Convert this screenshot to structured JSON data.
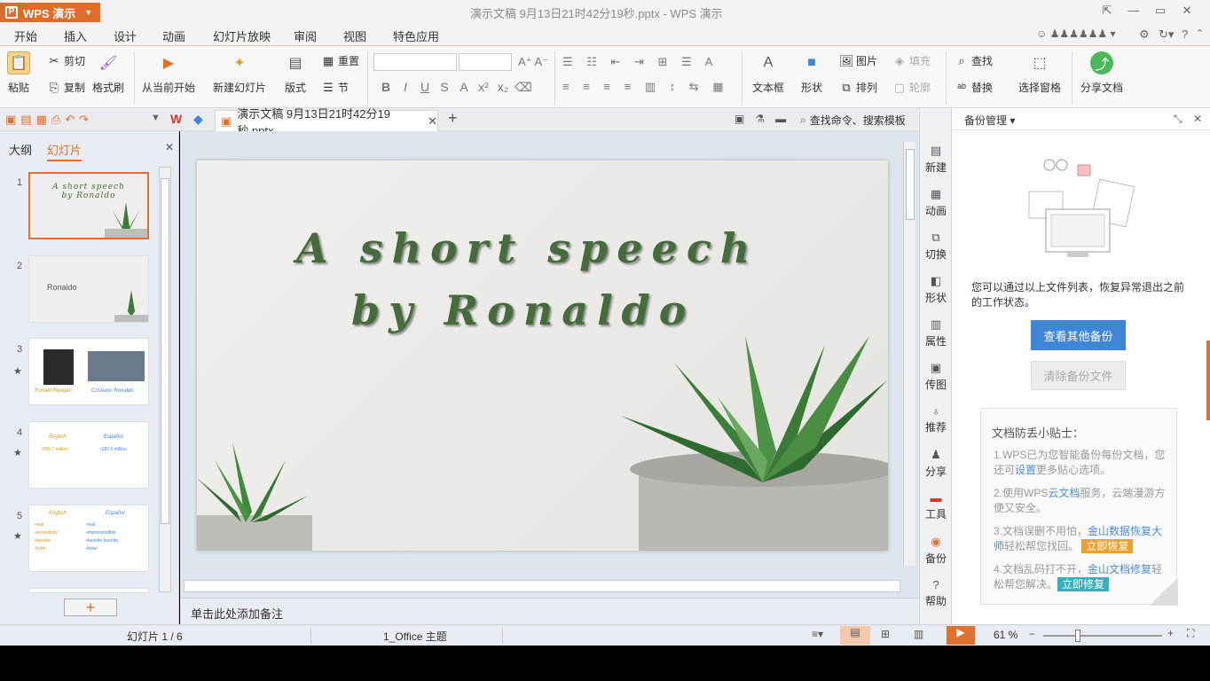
{
  "app": {
    "name": "WPS 演示",
    "doc_title": "演示文稿 9月13日21时42分19秒.pptx - WPS 演示"
  },
  "menu": [
    "开始",
    "插入",
    "设计",
    "动画",
    "幻灯片放映",
    "审阅",
    "视图",
    "特色应用"
  ],
  "ribbon": {
    "paste": "粘贴",
    "cut": "剪切",
    "copy": "复制",
    "format_painter": "格式刷",
    "from_current": "从当前开始",
    "new_slide": "新建幻灯片",
    "layout": "版式",
    "reset": "重置",
    "section": "节",
    "textbox": "文本框",
    "shape": "形状",
    "picture": "图片",
    "fill": "填充",
    "arrange": "排列",
    "outline": "轮廓",
    "find": "查找",
    "replace": "替换",
    "select_pane": "选择窗格",
    "share_doc": "分享文档"
  },
  "tabs": {
    "doc_tab": "演示文稿 9月13日21时42分19秒.pptx",
    "search_cmd": "查找命令、搜索模板"
  },
  "left_panel": {
    "tab_outline": "大纲",
    "tab_slides": "幻灯片"
  },
  "thumbs": {
    "t1": {
      "num": "1",
      "line1": "A short speech",
      "line2": "by Ronaldo"
    },
    "t2": {
      "num": "2",
      "text": "Ronaldo"
    },
    "t3": {
      "num": "3",
      "cap1": "Ronald Reagan",
      "cap2": "Cristiano Ronaldo"
    },
    "t4": {
      "num": "4",
      "h1": "English",
      "h2": "Español",
      "v1": "•300.7 million",
      "v2": "•383.5 million"
    },
    "t5": {
      "num": "5",
      "h1": "English",
      "h2": "Español",
      "c1": [
        "•real",
        "•serendipity",
        "•favorite",
        "•hotel"
      ],
      "c2": [
        "•real",
        "•imprescindible",
        "•favorito favorita",
        "•hotel"
      ]
    }
  },
  "slide": {
    "line1": "A short speech",
    "line2": "by Ronaldo"
  },
  "notes_placeholder": "单击此处添加备注",
  "side_tools": [
    "新建",
    "动画",
    "切换",
    "形状",
    "属性",
    "传图",
    "推荐",
    "分享",
    "工具",
    "备份",
    "帮助"
  ],
  "backup": {
    "title": "备份管理",
    "desc": "您可以通过以上文件列表，恢复异常退出之前的工作状态。",
    "view_other": "查看其他备份",
    "clear": "清除备份文件",
    "tips_title": "文档防丢小贴士：",
    "tip1_a": "1.WPS已为您智能备份每份文档，您还可",
    "tip1_link": "设置",
    "tip1_b": "更多贴心选项。",
    "tip2_a": "2.使用WPS",
    "tip2_link": "云文档",
    "tip2_b": "服务，云端漫游方便又安全。",
    "tip3_a": "3.文档误删不用怕，",
    "tip3_link": "金山数据恢复大师",
    "tip3_b": "轻松帮您找回。",
    "tip3_btn": "立即恢复",
    "tip4_a": "4.文档乱码打不开，",
    "tip4_link": "金山文档修复",
    "tip4_b": "轻松帮您解决。",
    "tip4_btn": "立即修复"
  },
  "status": {
    "slide_pos": "幻灯片 1 / 6",
    "theme": "1_Office 主题",
    "zoom": "61 %"
  },
  "colors": {
    "accent": "#e0702e",
    "primary_blue": "#3f86d6",
    "title_green": "#466b3d"
  }
}
